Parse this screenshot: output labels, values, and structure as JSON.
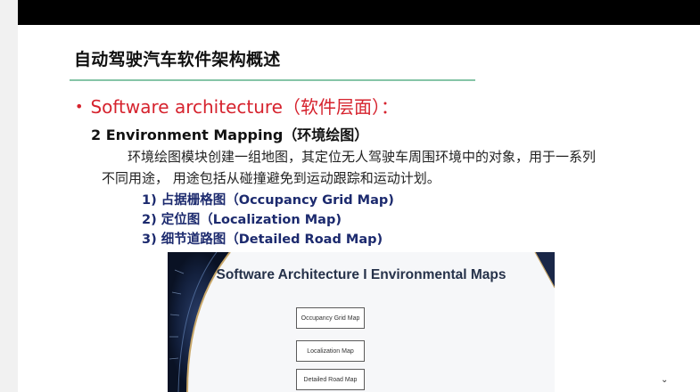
{
  "slide": {
    "title": "自动驾驶汽车软件架构概述",
    "bullet_text": "Software architecture（软件层面）：",
    "sub_heading": "2 Environment Mapping（环境绘图）",
    "paragraph_line1": "环境绘图模块创建一组地图，其定位无人驾驶车周围环境中的对象，用于一系列",
    "paragraph_line2": "不同用途， 用途包括从碰撞避免到运动跟踪和运动计划。",
    "list": [
      "1) 占据栅格图（Occupancy Grid Map)",
      "2) 定位图（Localization Map)",
      "3) 细节道路图（Detailed Road Map)"
    ]
  },
  "figure": {
    "title": "Software Architecture I Environmental Maps",
    "boxes": [
      "Occupancy Grid Map",
      "Localization Map",
      "Detailed Road Map"
    ]
  },
  "colors": {
    "title_rule": "#86c5a7",
    "bullet_red": "#d6232e",
    "list_blue": "#1c2a6e",
    "top_bar": "#000000"
  },
  "icons": {
    "bullet": "bullet-dot",
    "corner": "caret-icon"
  }
}
